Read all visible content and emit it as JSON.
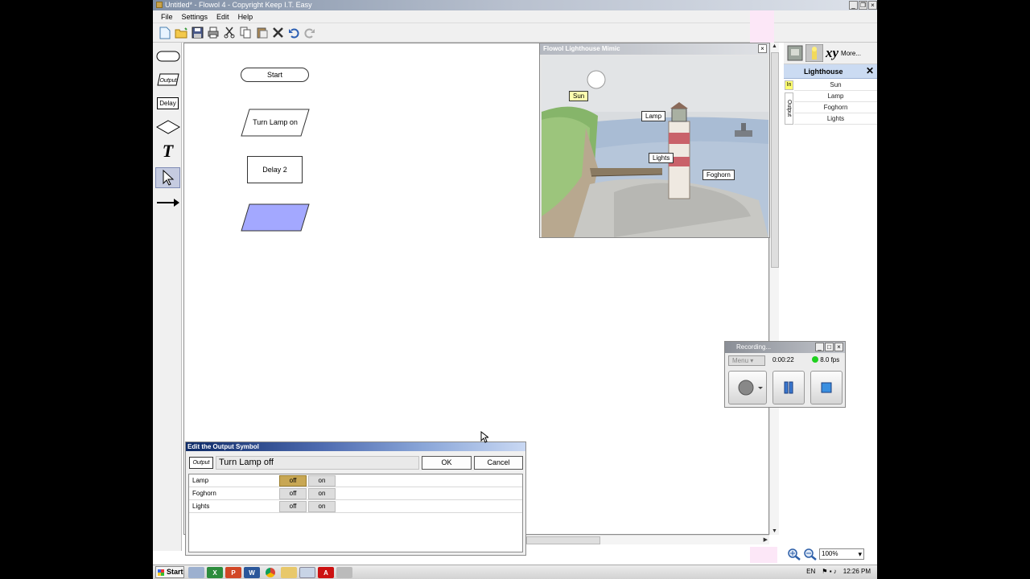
{
  "window": {
    "title": "Untitled* - Flowol 4 - Copyright Keep I.T. Easy",
    "controls": [
      "_",
      "❐",
      "×"
    ]
  },
  "menu": [
    "File",
    "Settings",
    "Edit",
    "Help"
  ],
  "palette": {
    "output_label": "Output",
    "delay_label": "Delay",
    "text_tool": "T"
  },
  "flowchart": {
    "start": "Start",
    "output1": "Turn Lamp on",
    "delay": "Delay 2"
  },
  "mimic": {
    "title": "Flowol Lighthouse Mimic",
    "close": "×",
    "labels": {
      "sun": "Sun",
      "lamp": "Lamp",
      "lights": "Lights",
      "foghorn": "Foghorn"
    }
  },
  "right_panel": {
    "more": "More...",
    "xy": "xy",
    "header": "Lighthouse",
    "close": "✕",
    "tab_in": "In",
    "tab_out": "Output",
    "items": [
      "Sun",
      "Lamp",
      "Foghorn",
      "Lights"
    ]
  },
  "recording": {
    "title": "Recording...",
    "menu": "Menu",
    "time": "0:00:22",
    "fps": "8.0 fps",
    "controls": [
      "_",
      "□",
      "×"
    ]
  },
  "dialog": {
    "title": "Edit the Output Symbol",
    "badge": "Output",
    "name": "Turn Lamp off",
    "ok": "OK",
    "cancel": "Cancel",
    "rows": [
      {
        "label": "Lamp",
        "off": "off",
        "on": "on",
        "selected": "off"
      },
      {
        "label": "Foghorn",
        "off": "off",
        "on": "on",
        "selected": "none"
      },
      {
        "label": "Lights",
        "off": "off",
        "on": "on",
        "selected": "none"
      }
    ]
  },
  "zoom": {
    "value": "100%"
  },
  "taskbar": {
    "start": "Start",
    "lang": "EN",
    "clock": "12:26 PM"
  },
  "colors": {
    "selected_toggle": "#c8a754",
    "output_symbol_fill": "#a3a8ff",
    "panel_header": "#cbdbf2"
  }
}
